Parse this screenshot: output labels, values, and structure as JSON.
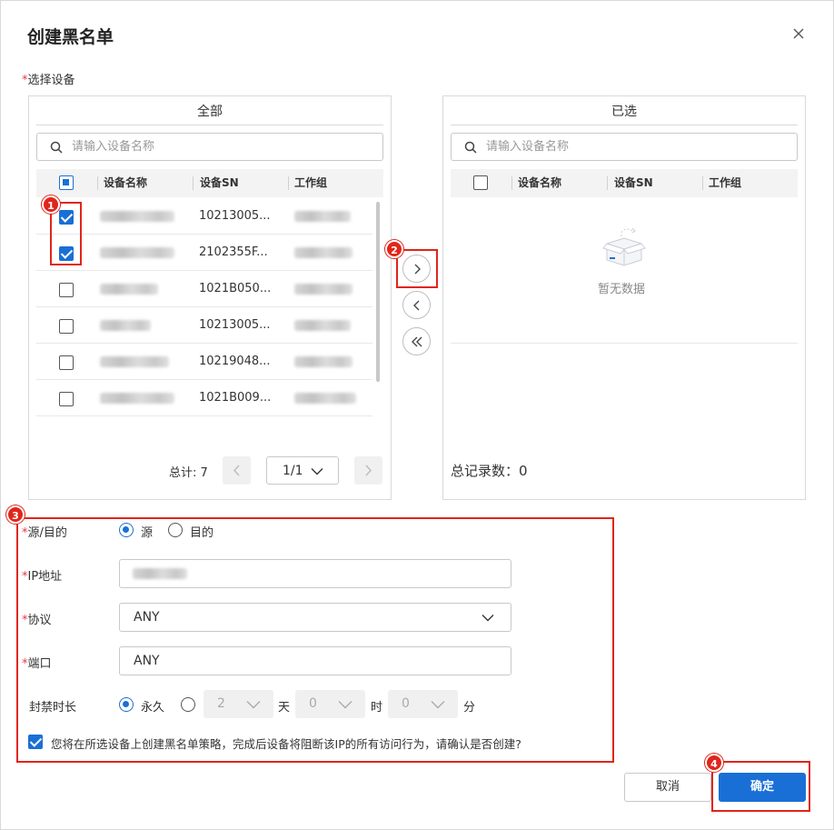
{
  "dialog": {
    "title": "创建黑名单"
  },
  "select_devices": {
    "label": "选择设备",
    "all_panel": {
      "title": "全部",
      "search_placeholder": "请输入设备名称",
      "columns": [
        "设备名称",
        "设备SN",
        "工作组"
      ],
      "rows": [
        {
          "sn": "10213005...",
          "checked": true
        },
        {
          "sn": "2102355F...",
          "checked": true
        },
        {
          "sn": "1021B050...",
          "checked": false
        },
        {
          "sn": "10213005...",
          "checked": false
        },
        {
          "sn": "10219048...",
          "checked": false
        },
        {
          "sn": "1021B009...",
          "checked": false
        }
      ],
      "total_label": "总计: 7",
      "page": "1/1"
    },
    "selected_panel": {
      "title": "已选",
      "search_placeholder": "请输入设备名称",
      "columns": [
        "设备名称",
        "设备SN",
        "工作组"
      ],
      "empty_text": "暂无数据",
      "total_label": "总记录数：0"
    }
  },
  "form": {
    "direction": {
      "label": "源/目的",
      "option_source": "源",
      "option_dest": "目的",
      "selected": "源"
    },
    "ip": {
      "label": "IP地址"
    },
    "protocol": {
      "label": "协议",
      "value": "ANY"
    },
    "port": {
      "label": "端口",
      "value": "ANY"
    },
    "duration": {
      "label": "封禁时长",
      "option_forever": "永久",
      "days": "2",
      "days_unit": "天",
      "hours": "0",
      "hours_unit": "时",
      "minutes": "0",
      "minutes_unit": "分"
    },
    "confirm_text": "您将在所选设备上创建黑名单策略，完成后设备将阻断该IP的所有访问行为，请确认是否创建?"
  },
  "buttons": {
    "cancel": "取消",
    "ok": "确定"
  },
  "badges": [
    "1",
    "2",
    "3",
    "4"
  ],
  "colors": {
    "accent": "#1a6fd6",
    "highlight": "#e1251b"
  }
}
